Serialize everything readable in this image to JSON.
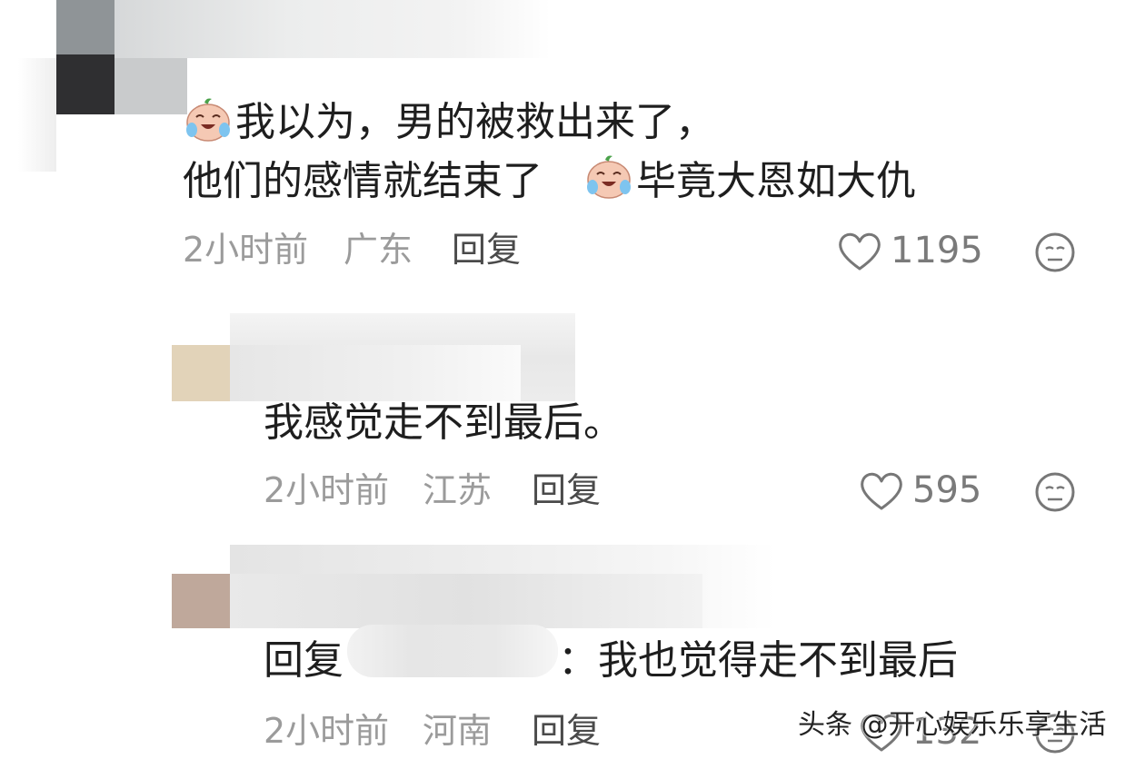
{
  "comments": [
    {
      "text_line1": "我以为，男的被救出来了，",
      "text_line2a": "他们的感情就结束了",
      "text_line2b": "毕竟大恩如大仇",
      "time": "2小时前",
      "location": "广东",
      "reply_label": "回复",
      "likes": "1195"
    },
    {
      "text": "我感觉走不到最后。",
      "time": "2小时前",
      "location": "江苏",
      "reply_label": "回复",
      "likes": "595"
    },
    {
      "text_prefix": "回复",
      "text_suffix": "：我也觉得走不到最后",
      "time": "2小时前",
      "location": "河南",
      "reply_label": "回复",
      "likes": "132"
    }
  ],
  "watermark": "头条 @开心娱乐乐享生活",
  "icons": {
    "emoji": "crying-laugh-emoji-icon",
    "like": "heart-icon",
    "dislike": "neutral-face-icon"
  },
  "colors": {
    "text": "#1e1e1e",
    "meta": "#9b9b9b",
    "reply": "#4a4a4a"
  }
}
